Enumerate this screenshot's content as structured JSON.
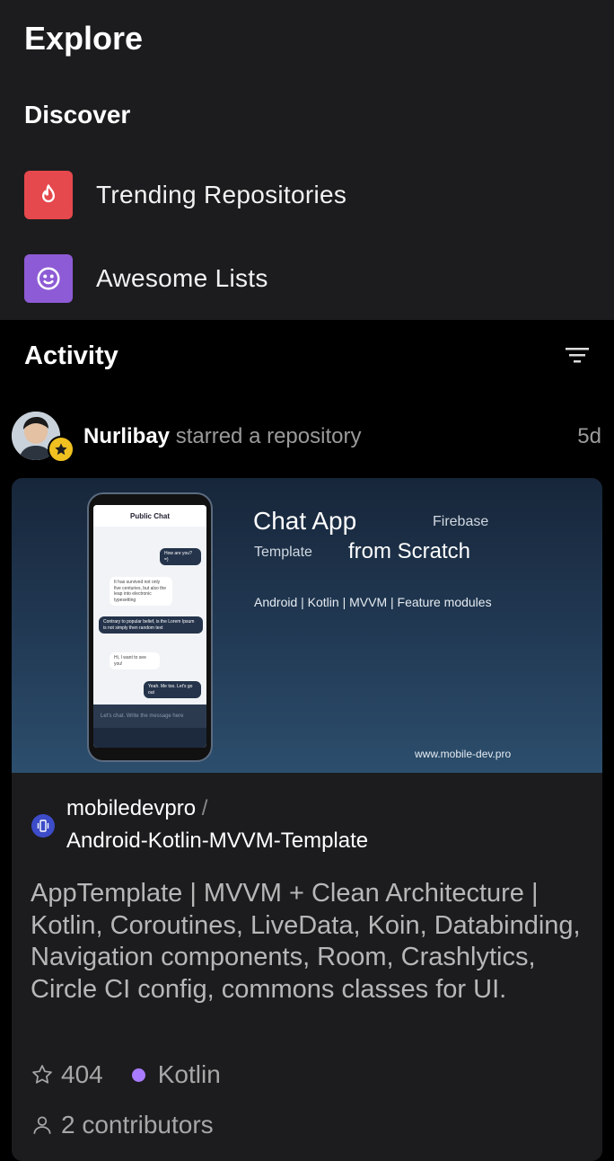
{
  "header": {
    "title": "Explore"
  },
  "discover": {
    "title": "Discover",
    "items": [
      {
        "label": "Trending Repositories",
        "icon": "flame-icon",
        "color": "#e5484d"
      },
      {
        "label": "Awesome Lists",
        "icon": "smiley-icon",
        "color": "#8e5bd6"
      }
    ]
  },
  "activity": {
    "title": "Activity",
    "filter_icon": "filter-icon",
    "item": {
      "user": "Nurlibay",
      "action": "starred a repository",
      "age": "5d",
      "banner": {
        "title": "Chat App",
        "word_firebase": "Firebase",
        "word_template": "Template",
        "subtitle": "from Scratch",
        "tags": "Android | Kotlin | MVVM | Feature modules",
        "site": "www.mobile-dev.pro",
        "phone": {
          "header": "Public Chat",
          "msg1": "How are you? =)",
          "msg2": "It has survived not only five centuries, but also the leap into electronic typesetting",
          "msg3": "Contrary to popular belief, is the Lorem Ipsum is not simply then random text",
          "msg4": "Hi, I want to see you!",
          "msg5": "Yeah. Me too. Let's go out",
          "input": "Let's chat. Write the message here"
        }
      },
      "repo": {
        "owner": "mobiledevpro",
        "separator": "/",
        "name": "Android-Kotlin-MVVM-Template",
        "description": "AppTemplate | MVVM + Clean Architecture | Kotlin, Coroutines, LiveData, Koin, Databinding, Navigation components, Room, Crashlytics, Circle CI config, commons classes for UI.",
        "stars": "404",
        "language": "Kotlin",
        "language_color": "#a97bff",
        "contributors": "2 contributors"
      }
    }
  }
}
